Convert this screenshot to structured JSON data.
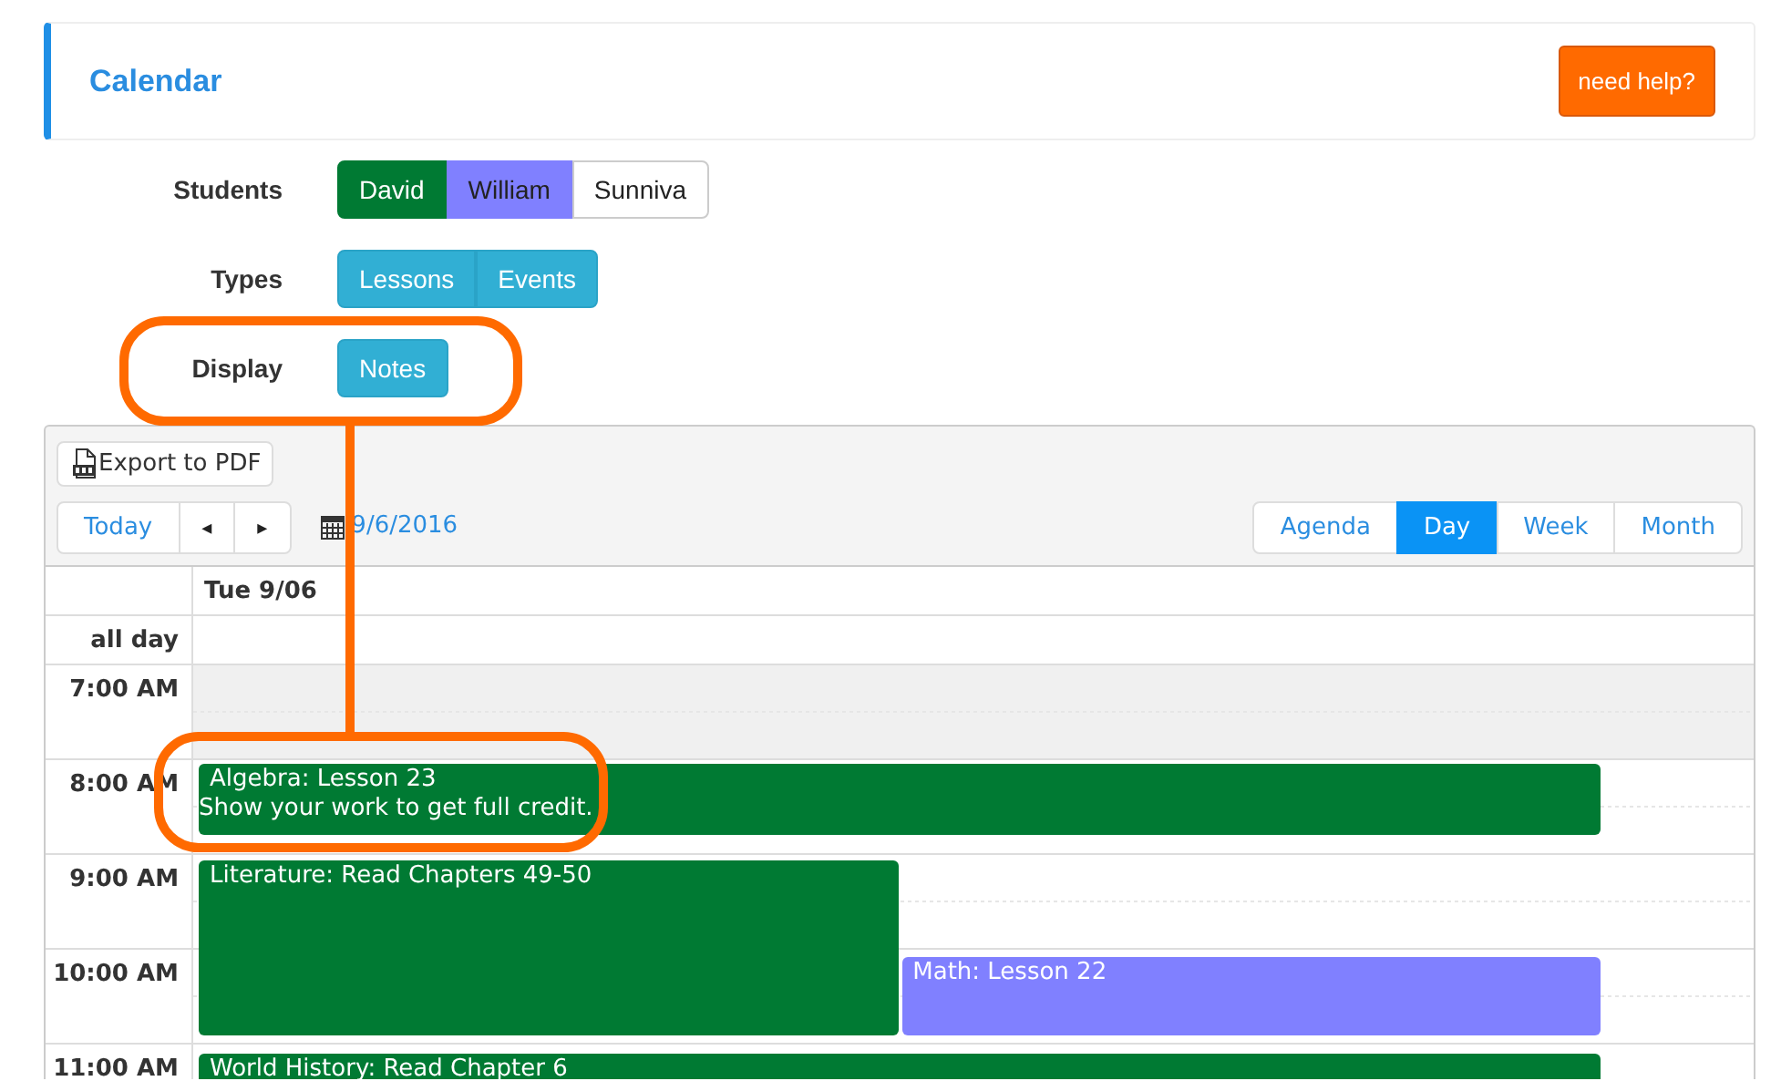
{
  "header": {
    "title": "Calendar",
    "help_button": "need help?"
  },
  "filters": [
    {
      "label": "Students",
      "options": [
        {
          "label": "David",
          "selected": true,
          "color": "#007a33"
        },
        {
          "label": "William",
          "selected": true,
          "color": "#8080ff"
        },
        {
          "label": "Sunniva",
          "selected": false
        }
      ]
    },
    {
      "label": "Types",
      "options": [
        {
          "label": "Lessons",
          "selected": true
        },
        {
          "label": "Events",
          "selected": true
        }
      ]
    },
    {
      "label": "Display",
      "options": [
        {
          "label": "Notes",
          "selected": true
        }
      ]
    }
  ],
  "calendar": {
    "export_button": "Export to PDF",
    "today_button": "Today",
    "prev_button": "◂",
    "next_button": "▸",
    "date": "9/6/2016",
    "views": [
      {
        "label": "Agenda",
        "selected": false
      },
      {
        "label": "Day",
        "selected": true
      },
      {
        "label": "Week",
        "selected": false
      },
      {
        "label": "Month",
        "selected": false
      }
    ],
    "day_header": "Tue 9/06",
    "all_day_label": "all day",
    "hours": [
      {
        "label": "7:00 AM",
        "shaded": true
      },
      {
        "label": "8:00 AM",
        "shaded": false,
        "events": [
          {
            "title": "Algebra: Lesson 23",
            "note": "Show your work to get full credit.",
            "color": "#007a33"
          }
        ]
      },
      {
        "label": "9:00 AM",
        "shaded": false,
        "events": [
          {
            "title": "Literature: Read Chapters 49-50",
            "color": "#007a33"
          }
        ]
      },
      {
        "label": "10:00 AM",
        "shaded": false,
        "events": [
          {
            "title": "Math: Lesson 22",
            "color": "#8080ff"
          }
        ]
      },
      {
        "label": "11:00 AM",
        "shaded": false,
        "events": [
          {
            "title": "World History: Read Chapter 6",
            "color": "#007a33"
          }
        ]
      }
    ]
  }
}
